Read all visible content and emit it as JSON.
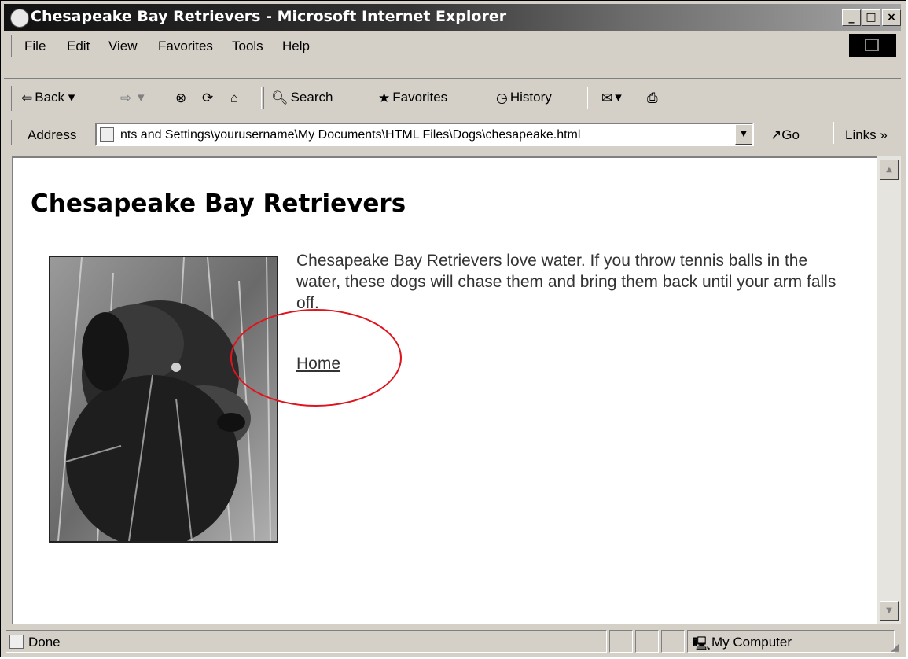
{
  "window": {
    "title": "Chesapeake Bay Retrievers - Microsoft Internet Explorer",
    "controls": {
      "minimize": "_",
      "maximize": "□",
      "close": "×"
    }
  },
  "menu": [
    "File",
    "Edit",
    "View",
    "Favorites",
    "Tools",
    "Help"
  ],
  "toolbar": {
    "back": "Back",
    "search": "Search",
    "favorites": "Favorites",
    "history": "History"
  },
  "address": {
    "label": "Address",
    "value": "nts and Settings\\yourusername\\My Documents\\HTML Files\\Dogs\\chesapeake.html",
    "go": "Go",
    "links": "Links"
  },
  "page": {
    "heading": "Chesapeake Bay Retrievers",
    "paragraph": "Chesapeake Bay Retrievers love water. If you throw tennis balls in the water, these dogs will chase them and bring them back until your arm falls off.",
    "home_link": "Home"
  },
  "status": {
    "text": "Done",
    "zone": "My Computer"
  },
  "colors": {
    "annotation_circle": "#e0141c"
  },
  "icons": [
    "ie-page-icon",
    "windows-logo-icon",
    "back-arrow-icon",
    "forward-arrow-icon",
    "stop-icon",
    "refresh-icon",
    "home-icon",
    "search-icon",
    "favorites-icon",
    "history-icon",
    "mail-icon",
    "print-icon",
    "go-arrow-icon",
    "my-computer-icon",
    "size-grip-icon"
  ]
}
